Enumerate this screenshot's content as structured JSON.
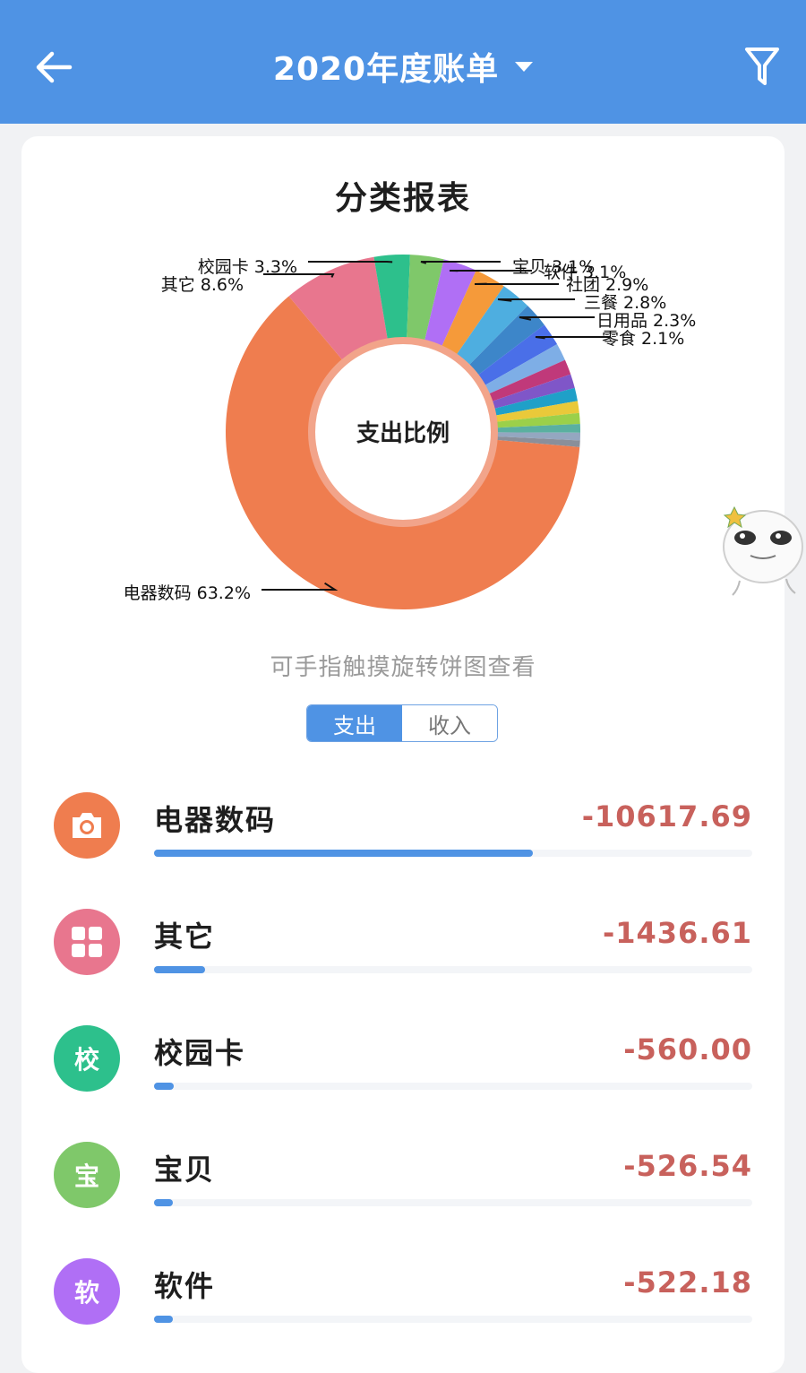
{
  "header": {
    "title": "2020年度账单",
    "back_icon": "arrow-left-icon",
    "filter_icon": "filter-icon",
    "dropdown_icon": "caret-down-icon",
    "bg_color": "#4f93e4"
  },
  "card": {
    "title": "分类报表",
    "hint": "可手指触摸旋转饼图查看",
    "tabs": [
      {
        "label": "支出",
        "active": true
      },
      {
        "label": "收入",
        "active": false
      }
    ]
  },
  "chart_data": {
    "type": "pie",
    "center_label": "支出比例",
    "slices": [
      {
        "label": "电器数码",
        "percent": 63.2,
        "color": "#ef7d4f",
        "shown_label": "电器数码 63.2%"
      },
      {
        "label": "其它",
        "percent": 8.6,
        "color": "#e8768e",
        "shown_label": "其它 8.6%"
      },
      {
        "label": "校园卡",
        "percent": 3.3,
        "color": "#2dc08c",
        "shown_label": "校园卡 3.3%"
      },
      {
        "label": "宝贝",
        "percent": 3.1,
        "color": "#7fc86a",
        "shown_label": "宝贝 3.1%"
      },
      {
        "label": "软件",
        "percent": 3.1,
        "color": "#b06ff5",
        "shown_label": "软件 3.1%"
      },
      {
        "label": "社团",
        "percent": 2.9,
        "color": "#f59a3a",
        "shown_label": "社团 2.9%"
      },
      {
        "label": "三餐",
        "percent": 2.8,
        "color": "#4eaee0",
        "shown_label": "三餐 2.8%"
      },
      {
        "label": "日用品",
        "percent": 2.3,
        "color": "#3d86c9",
        "shown_label": "日用品 2.3%"
      },
      {
        "label": "零食",
        "percent": 2.1,
        "color": "#4a6fe8",
        "shown_label": "零食 2.1%"
      },
      {
        "label": "",
        "percent": 1.6,
        "color": "#7eaee6",
        "shown_label": ""
      },
      {
        "label": "",
        "percent": 1.4,
        "color": "#c0397a",
        "shown_label": ""
      },
      {
        "label": "",
        "percent": 1.3,
        "color": "#7f56c8",
        "shown_label": ""
      },
      {
        "label": "",
        "percent": 1.2,
        "color": "#1fa0c8",
        "shown_label": ""
      },
      {
        "label": "",
        "percent": 1.1,
        "color": "#e9c93a",
        "shown_label": ""
      },
      {
        "label": "",
        "percent": 1.0,
        "color": "#9bd04a",
        "shown_label": ""
      },
      {
        "label": "",
        "percent": 0.8,
        "color": "#5ab0a0",
        "shown_label": ""
      },
      {
        "label": "",
        "percent": 0.7,
        "color": "#94a7c0",
        "shown_label": ""
      },
      {
        "label": "",
        "percent": 0.6,
        "color": "#8a8f9a",
        "shown_label": ""
      }
    ]
  },
  "categories": [
    {
      "name": "电器数码",
      "amount": "-10617.69",
      "icon": "camera-icon",
      "icon_text": "",
      "color": "#ef7d4f",
      "share": 0.633
    },
    {
      "name": "其它",
      "amount": "-1436.61",
      "icon": "grid-icon",
      "icon_text": "",
      "color": "#e8768e",
      "share": 0.086
    },
    {
      "name": "校园卡",
      "amount": "-560.00",
      "icon": "school-card-icon",
      "icon_text": "校",
      "color": "#2dc08c",
      "share": 0.033
    },
    {
      "name": "宝贝",
      "amount": "-526.54",
      "icon": "baby-icon",
      "icon_text": "宝",
      "color": "#7fc86a",
      "share": 0.031
    },
    {
      "name": "软件",
      "amount": "-522.18",
      "icon": "software-icon",
      "icon_text": "软",
      "color": "#b06ff5",
      "share": 0.031
    }
  ],
  "sticker": {
    "icon": "meme-face-sticker-icon"
  }
}
